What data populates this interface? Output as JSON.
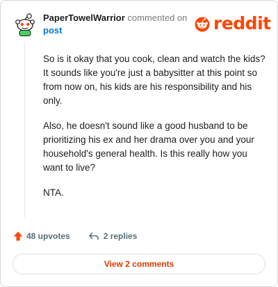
{
  "header": {
    "username": "PaperTowelWarrior",
    "action_text": "commented on",
    "post_link": "post",
    "brand": "reddit",
    "brand_color": "#ff4500"
  },
  "comment": {
    "paragraphs": [
      "So is it okay that you cook, clean and watch the kids? It sounds like you're just a babysitter at this point so from now on, his kids are his responsibility and his only.",
      "Also, he doesn't sound like a good husband to be prioritizing his ex and her drama over you and your household's general health. Is this really how you want to live?",
      "NTA."
    ]
  },
  "actions": {
    "upvotes_label": "48 upvotes",
    "replies_label": "2 replies",
    "upvote_color": "#ff4500",
    "upvote_icon": "upvote-arrow-icon",
    "reply_icon": "reply-arrow-icon"
  },
  "footer": {
    "view_comments_label": "View 2 comments",
    "link_color": "#d93a00"
  }
}
